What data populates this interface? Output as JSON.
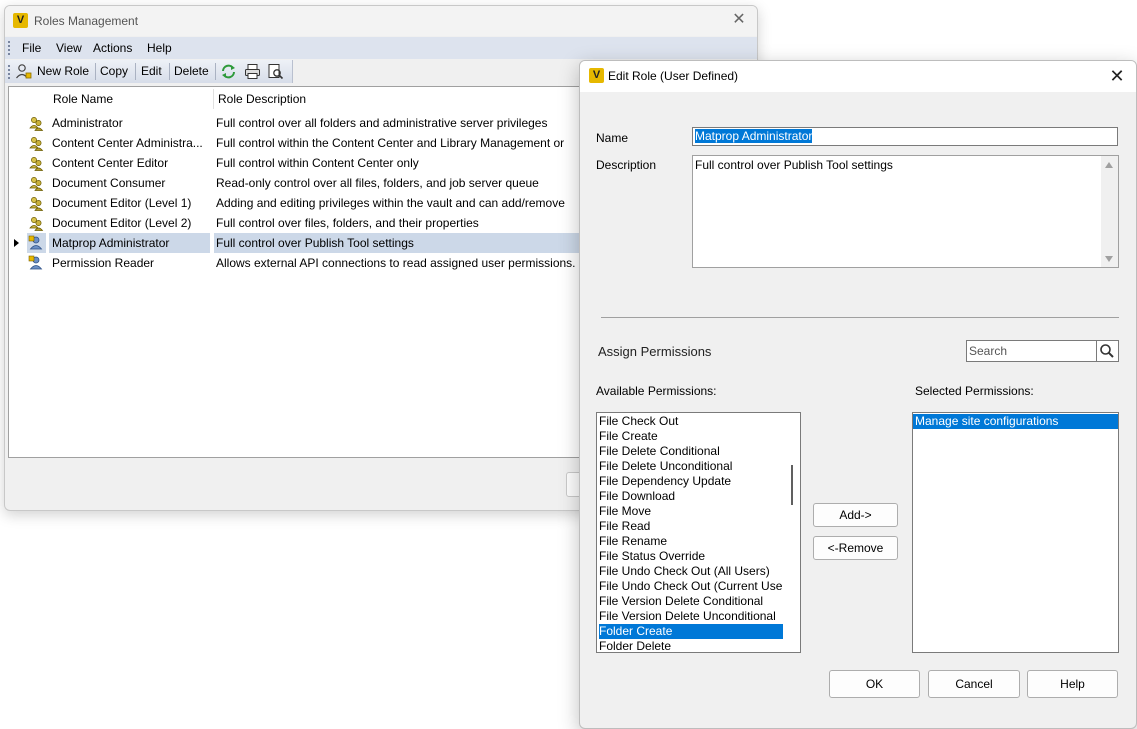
{
  "roles_window": {
    "title": "Roles Management",
    "menu": [
      "File",
      "View",
      "Actions",
      "Help"
    ],
    "toolbar": {
      "new_role": "New Role",
      "copy": "Copy",
      "edit": "Edit",
      "delete": "Delete"
    },
    "columns": [
      "Role Name",
      "Role Description"
    ],
    "rows": [
      {
        "name": "Administrator",
        "description": "Full control over all folders and administrative server privileges",
        "icon": "role-group-icon"
      },
      {
        "name": "Content Center Administra...",
        "description": "Full control within the Content Center and Library Management or",
        "icon": "role-group-icon"
      },
      {
        "name": "Content Center Editor",
        "description": "Full control within Content Center only",
        "icon": "role-group-icon"
      },
      {
        "name": "Document Consumer",
        "description": "Read-only control over all files, folders, and job server queue",
        "icon": "role-group-icon"
      },
      {
        "name": "Document Editor (Level 1)",
        "description": "Adding and editing privileges within the vault and can add/remove",
        "icon": "role-group-icon"
      },
      {
        "name": "Document Editor (Level 2)",
        "description": "Full control over files, folders, and their properties",
        "icon": "role-group-icon"
      },
      {
        "name": "Matprop Administrator",
        "description": "Full control over Publish Tool settings",
        "icon": "role-user-icon"
      },
      {
        "name": "Permission Reader",
        "description": "Allows external API connections to read assigned user permissions.",
        "icon": "role-user-icon"
      }
    ],
    "selected_row": 6
  },
  "edit_dialog": {
    "title": "Edit Role (User Defined)",
    "name_label": "Name",
    "name_value": "Matprop Administrator",
    "description_label": "Description",
    "description_value": "Full control over Publish Tool settings",
    "assign_label": "Assign Permissions",
    "search_placeholder": "Search",
    "available_label": "Available Permissions:",
    "selected_label": "Selected Permissions:",
    "available": [
      "File Check Out",
      "File Create",
      "File Delete Conditional",
      "File Delete Unconditional",
      "File Dependency Update",
      "File Download",
      "File Move",
      "File Read",
      "File Rename",
      "File Status Override",
      "File Undo Check Out (All Users)",
      "File Undo Check Out (Current User)",
      "File Version Delete Conditional",
      "File Version Delete Unconditional",
      "Folder Create",
      "Folder Delete"
    ],
    "available_selected_index": 14,
    "selected": [
      "Manage site configurations"
    ],
    "add_button": "Add->",
    "remove_button": "<-Remove",
    "ok_button": "OK",
    "cancel_button": "Cancel",
    "help_button": "Help"
  },
  "colors": {
    "selection": "#0078d7",
    "row_selection": "#ccd8e8",
    "menubar": "#dde3ee",
    "app_icon": "#e6b800"
  }
}
